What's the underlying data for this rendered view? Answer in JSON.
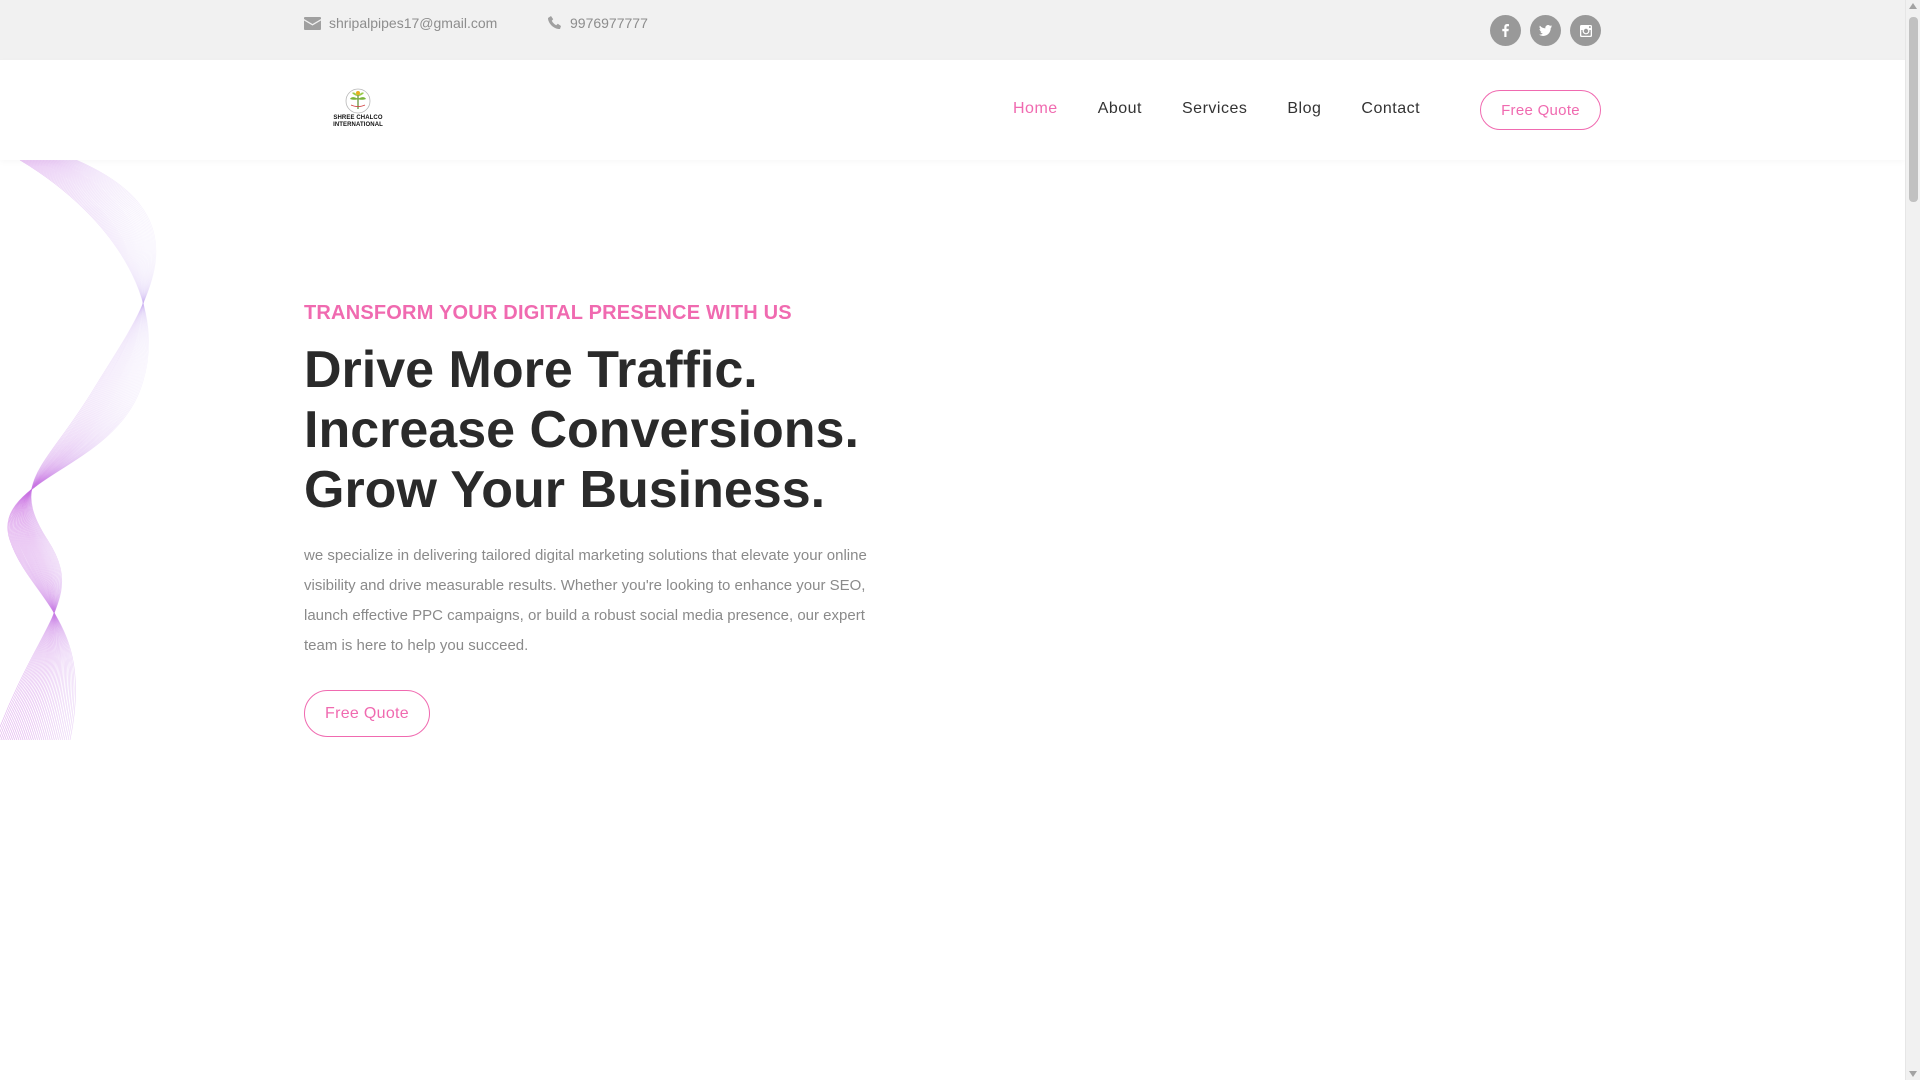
{
  "topbar": {
    "email": "shripalpipes17@gmail.com",
    "phone": "9976977777",
    "social": [
      {
        "icon": "facebook-icon",
        "glyph": "f"
      },
      {
        "icon": "twitter-icon",
        "glyph": "t"
      },
      {
        "icon": "instagram-icon",
        "glyph": "i"
      }
    ]
  },
  "header": {
    "logo_text_line1": "SHREE CHALCO",
    "logo_text_line2": "INTERNATIONAL",
    "nav": [
      {
        "label": "Home",
        "active": true
      },
      {
        "label": "About",
        "active": false
      },
      {
        "label": "Services",
        "active": false
      },
      {
        "label": "Blog",
        "active": false
      },
      {
        "label": "Contact",
        "active": false
      }
    ],
    "quote_button": "Free Quote"
  },
  "hero": {
    "subtitle": "TRANSFORM YOUR DIGITAL PRESENCE WITH US",
    "title_lines": [
      "Drive More Traffic.",
      "Increase Conversions.",
      "Grow Your Business."
    ],
    "description": "we specialize in delivering tailored digital marketing solutions that elevate your online visibility and drive measurable results. Whether you're looking to enhance your SEO, launch effective PPC campaigns, or build a robust social media presence, our expert team is here to help you succeed.",
    "button": "Free Quote"
  },
  "colors": {
    "accent": "#f06ab0",
    "topbar_bg": "#f1f1f1",
    "text_dark": "#2a2a2a",
    "text_muted": "#8a8a8a"
  }
}
